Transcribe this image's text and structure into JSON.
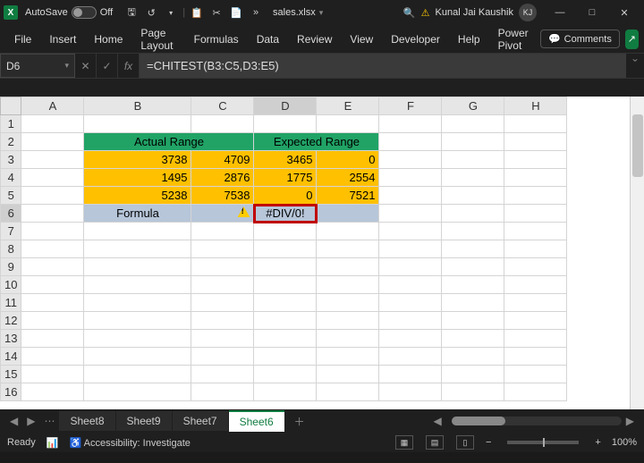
{
  "titlebar": {
    "autosave_label": "AutoSave",
    "autosave_state": "Off",
    "filename": "sales.xlsx",
    "user_name": "Kunal Jai Kaushik",
    "user_initials": "KJ"
  },
  "ribbon": {
    "tabs": [
      "File",
      "Insert",
      "Home",
      "Page Layout",
      "Formulas",
      "Data",
      "Review",
      "View",
      "Developer",
      "Help",
      "Power Pivot"
    ],
    "comments_label": "Comments"
  },
  "formula_bar": {
    "cell_ref": "D6",
    "formula": "=CHITEST(B3:C5,D3:E5)"
  },
  "grid": {
    "columns": [
      "A",
      "B",
      "C",
      "D",
      "E",
      "F",
      "G",
      "H"
    ],
    "row_count": 17,
    "headers": {
      "actual": "Actual Range",
      "expected": "Expected Range"
    },
    "data": {
      "B3": 3738,
      "C3": 4709,
      "D3": 3465,
      "E3": 0,
      "B4": 1495,
      "C4": 2876,
      "D4": 1775,
      "E4": 2554,
      "B5": 5238,
      "C5": 7538,
      "D5": 0,
      "E5": 7521
    },
    "row6": {
      "label": "Formula",
      "result": "#DIV/0!"
    },
    "active_col": "D",
    "active_row": 6
  },
  "sheet_tabs": {
    "tabs": [
      "Sheet8",
      "Sheet9",
      "Sheet7",
      "Sheet6"
    ],
    "active": "Sheet6"
  },
  "status": {
    "ready": "Ready",
    "accessibility": "Accessibility: Investigate",
    "zoom": "100%"
  }
}
